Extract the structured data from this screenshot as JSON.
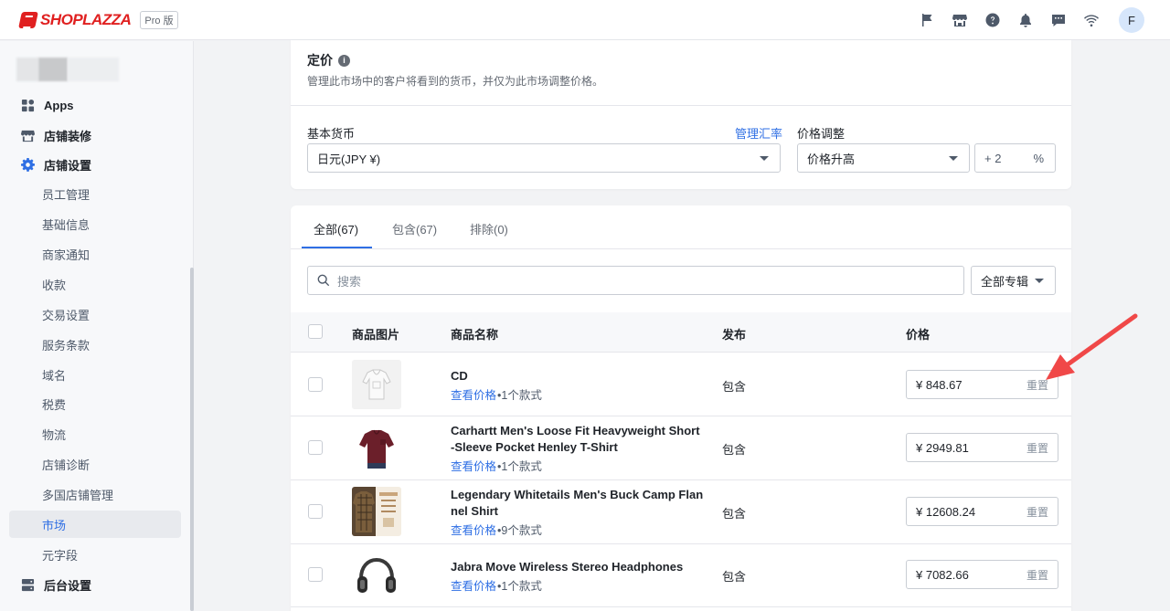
{
  "header": {
    "logo_text": "SHOPLAZZA",
    "plan_badge": "Pro 版",
    "icons": [
      "flag-icon",
      "store-icon",
      "help-icon",
      "bell-icon",
      "message-icon",
      "wifi-icon"
    ],
    "avatar_letter": "F"
  },
  "sidebar": {
    "items": [
      {
        "label": "Apps",
        "icon": "apps-icon"
      },
      {
        "label": "店铺装修",
        "icon": "store-icon"
      },
      {
        "label": "店铺设置",
        "icon": "gear-icon"
      }
    ],
    "sub_items": [
      "员工管理",
      "基础信息",
      "商家通知",
      "收款",
      "交易设置",
      "服务条款",
      "域名",
      "税费",
      "物流",
      "店铺诊断",
      "多国店铺管理",
      "市场",
      "元字段"
    ],
    "active_sub": "市场",
    "bottom_item": {
      "label": "后台设置",
      "icon": "server-icon"
    }
  },
  "pricing": {
    "title": "定价",
    "description": "管理此市场中的客户将看到的货币，并仅为此市场调整价格。",
    "base_currency_label": "基本货币",
    "manage_rate_link": "管理汇率",
    "base_currency_value": "日元(JPY ¥)",
    "adjust_label": "价格调整",
    "adjust_value": "价格升高",
    "adjust_amount": "+ 2",
    "adjust_unit": "%"
  },
  "tabs": [
    {
      "label": "全部(67)",
      "active": true
    },
    {
      "label": "包含(67)",
      "active": false
    },
    {
      "label": "排除(0)",
      "active": false
    }
  ],
  "search": {
    "placeholder": "搜索"
  },
  "filter": {
    "label": "全部专辑"
  },
  "table": {
    "headers": {
      "image": "商品图片",
      "name": "商品名称",
      "publish": "发布",
      "price": "价格"
    },
    "view_price_link": "查看价格",
    "reset_label": "重置",
    "rows": [
      {
        "name": "CD",
        "variants": "•1个款式",
        "publish": "包含",
        "price": "¥ 848.67"
      },
      {
        "name": "Carhartt Men's Loose Fit Heavyweight Short -Sleeve Pocket Henley T-Shirt",
        "variants": "•1个款式",
        "publish": "包含",
        "price": "¥ 2949.81"
      },
      {
        "name": "Legendary Whitetails Men's Buck Camp Flan nel Shirt",
        "variants": "•9个款式",
        "publish": "包含",
        "price": "¥ 12608.24"
      },
      {
        "name": "Jabra Move Wireless Stereo Headphones",
        "variants": "•1个款式",
        "publish": "包含",
        "price": "¥ 7082.66"
      }
    ]
  },
  "colors": {
    "accent": "#2f6fe4",
    "brand": "#e02020",
    "annotation_arrow": "#f04848"
  }
}
